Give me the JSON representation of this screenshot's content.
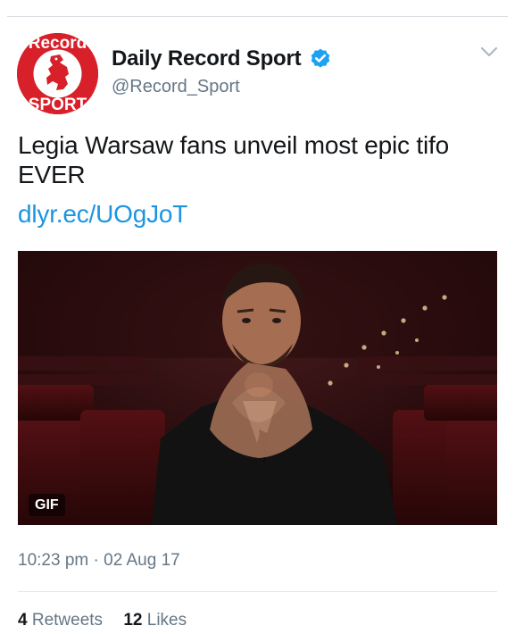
{
  "account": {
    "display_name": "Daily Record Sport",
    "handle": "@Record_Sport",
    "avatar_text_top": "Record",
    "avatar_text_bottom": "SPORT",
    "verified": true,
    "avatar_color": "#d8202a"
  },
  "tweet": {
    "text": "Legia Warsaw fans unveil most epic tifo EVER",
    "link": "dlyr.ec/UOgJoT",
    "media_badge": "GIF",
    "timestamp": "10:23 pm",
    "separator": "·",
    "date": "02 Aug 17"
  },
  "stats": {
    "retweets_count": "4",
    "retweets_label": "Retweets",
    "likes_count": "12",
    "likes_label": "Likes"
  },
  "colors": {
    "link": "#1b95e0",
    "secondary_text": "#657786",
    "verified": "#1da1f2"
  },
  "icons": {
    "verified": "verified-badge-icon",
    "menu": "chevron-down-icon"
  }
}
